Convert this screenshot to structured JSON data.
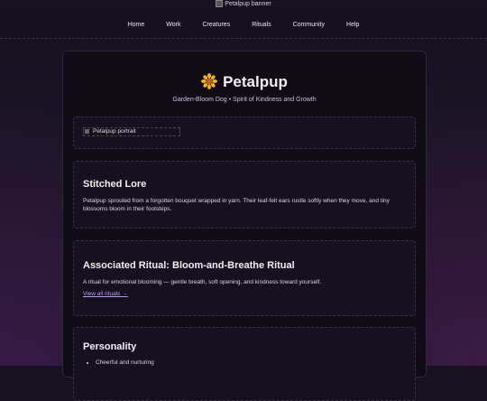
{
  "banner": {
    "alt": "Petalpup banner"
  },
  "nav": {
    "items": [
      "Home",
      "Work",
      "Creatures",
      "Rituals",
      "Community",
      "Help"
    ]
  },
  "header": {
    "title": "Petalpup",
    "subtitle": "Garden-Bloom Dog • Spirit of Kindness and Growth",
    "icon": "sunflower-icon"
  },
  "portrait": {
    "alt": "Petalpup portrait"
  },
  "lore": {
    "heading": "Stitched Lore",
    "text": "Petalpup sprouted from a forgotten bouquet wrapped in yarn. Their leaf-felt ears rustle softly when they move, and tiny blossoms bloom in their footsteps."
  },
  "ritual": {
    "heading": "Associated Ritual: Bloom-and-Breathe Ritual",
    "text": "A ritual for emotional blooming — gentle breath, soft opening, and kindness toward yourself.",
    "link": "View all rituals →"
  },
  "personality": {
    "heading": "Personality",
    "traits": [
      "Cheerful and nurturing"
    ]
  }
}
